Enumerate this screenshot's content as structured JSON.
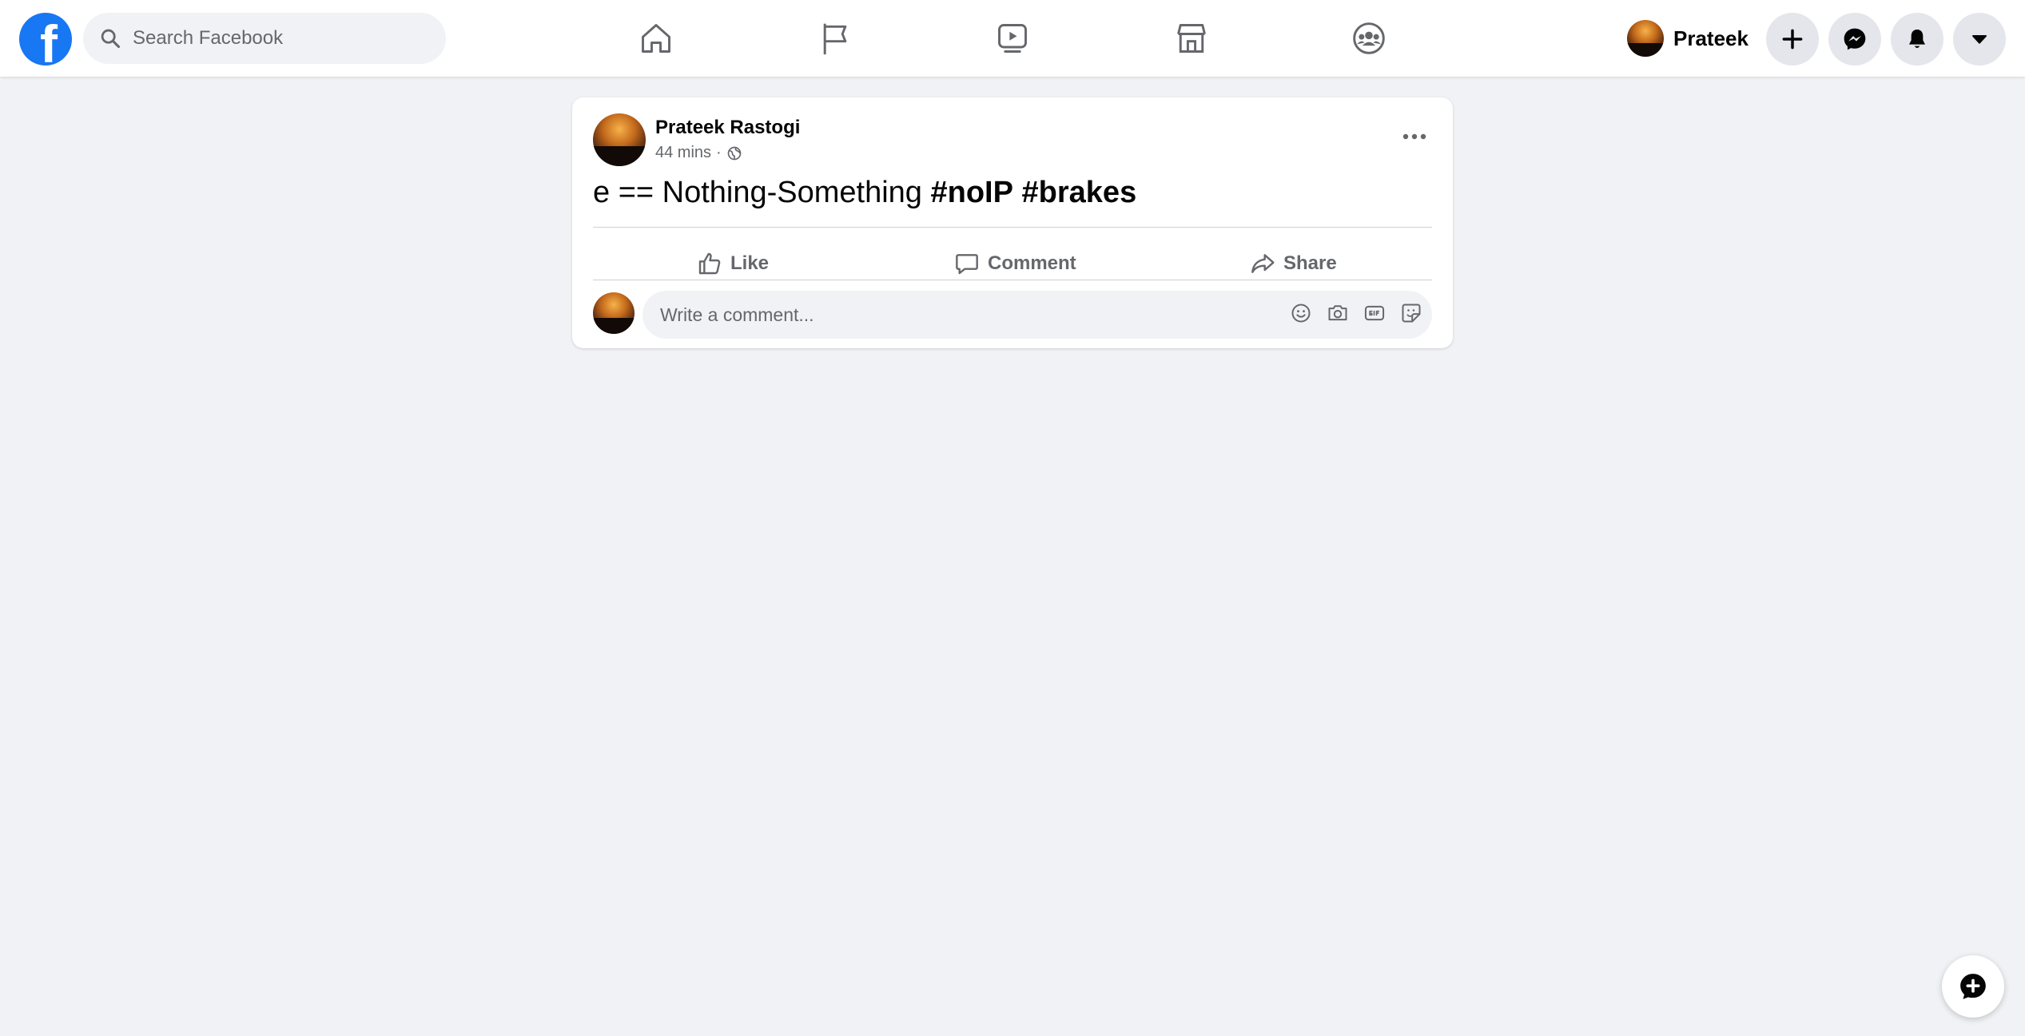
{
  "header": {
    "logo_letter": "f",
    "search_placeholder": "Search Facebook",
    "nav": [
      {
        "icon": "home-icon"
      },
      {
        "icon": "flag-icon"
      },
      {
        "icon": "watch-icon"
      },
      {
        "icon": "marketplace-icon"
      },
      {
        "icon": "groups-icon"
      }
    ],
    "profile_name": "Prateek",
    "buttons": [
      "create-icon",
      "messenger-icon",
      "notifications-icon",
      "account-menu-icon"
    ]
  },
  "post": {
    "author": "Prateek Rastogi",
    "time": "44 mins",
    "separator": "·",
    "audience_icon": "globe-icon",
    "text_plain": "e == Nothing-Something ",
    "hashtags": [
      "#noIP",
      "#brakes"
    ],
    "actions": {
      "like": "Like",
      "comment": "Comment",
      "share": "Share"
    },
    "comment_placeholder": "Write a comment...",
    "comment_tools": [
      "emoji-icon",
      "camera-icon",
      "gif-icon",
      "sticker-icon"
    ]
  },
  "colors": {
    "brand": "#1877f2",
    "background": "#f0f2f5",
    "secondary_text": "#65676b"
  }
}
